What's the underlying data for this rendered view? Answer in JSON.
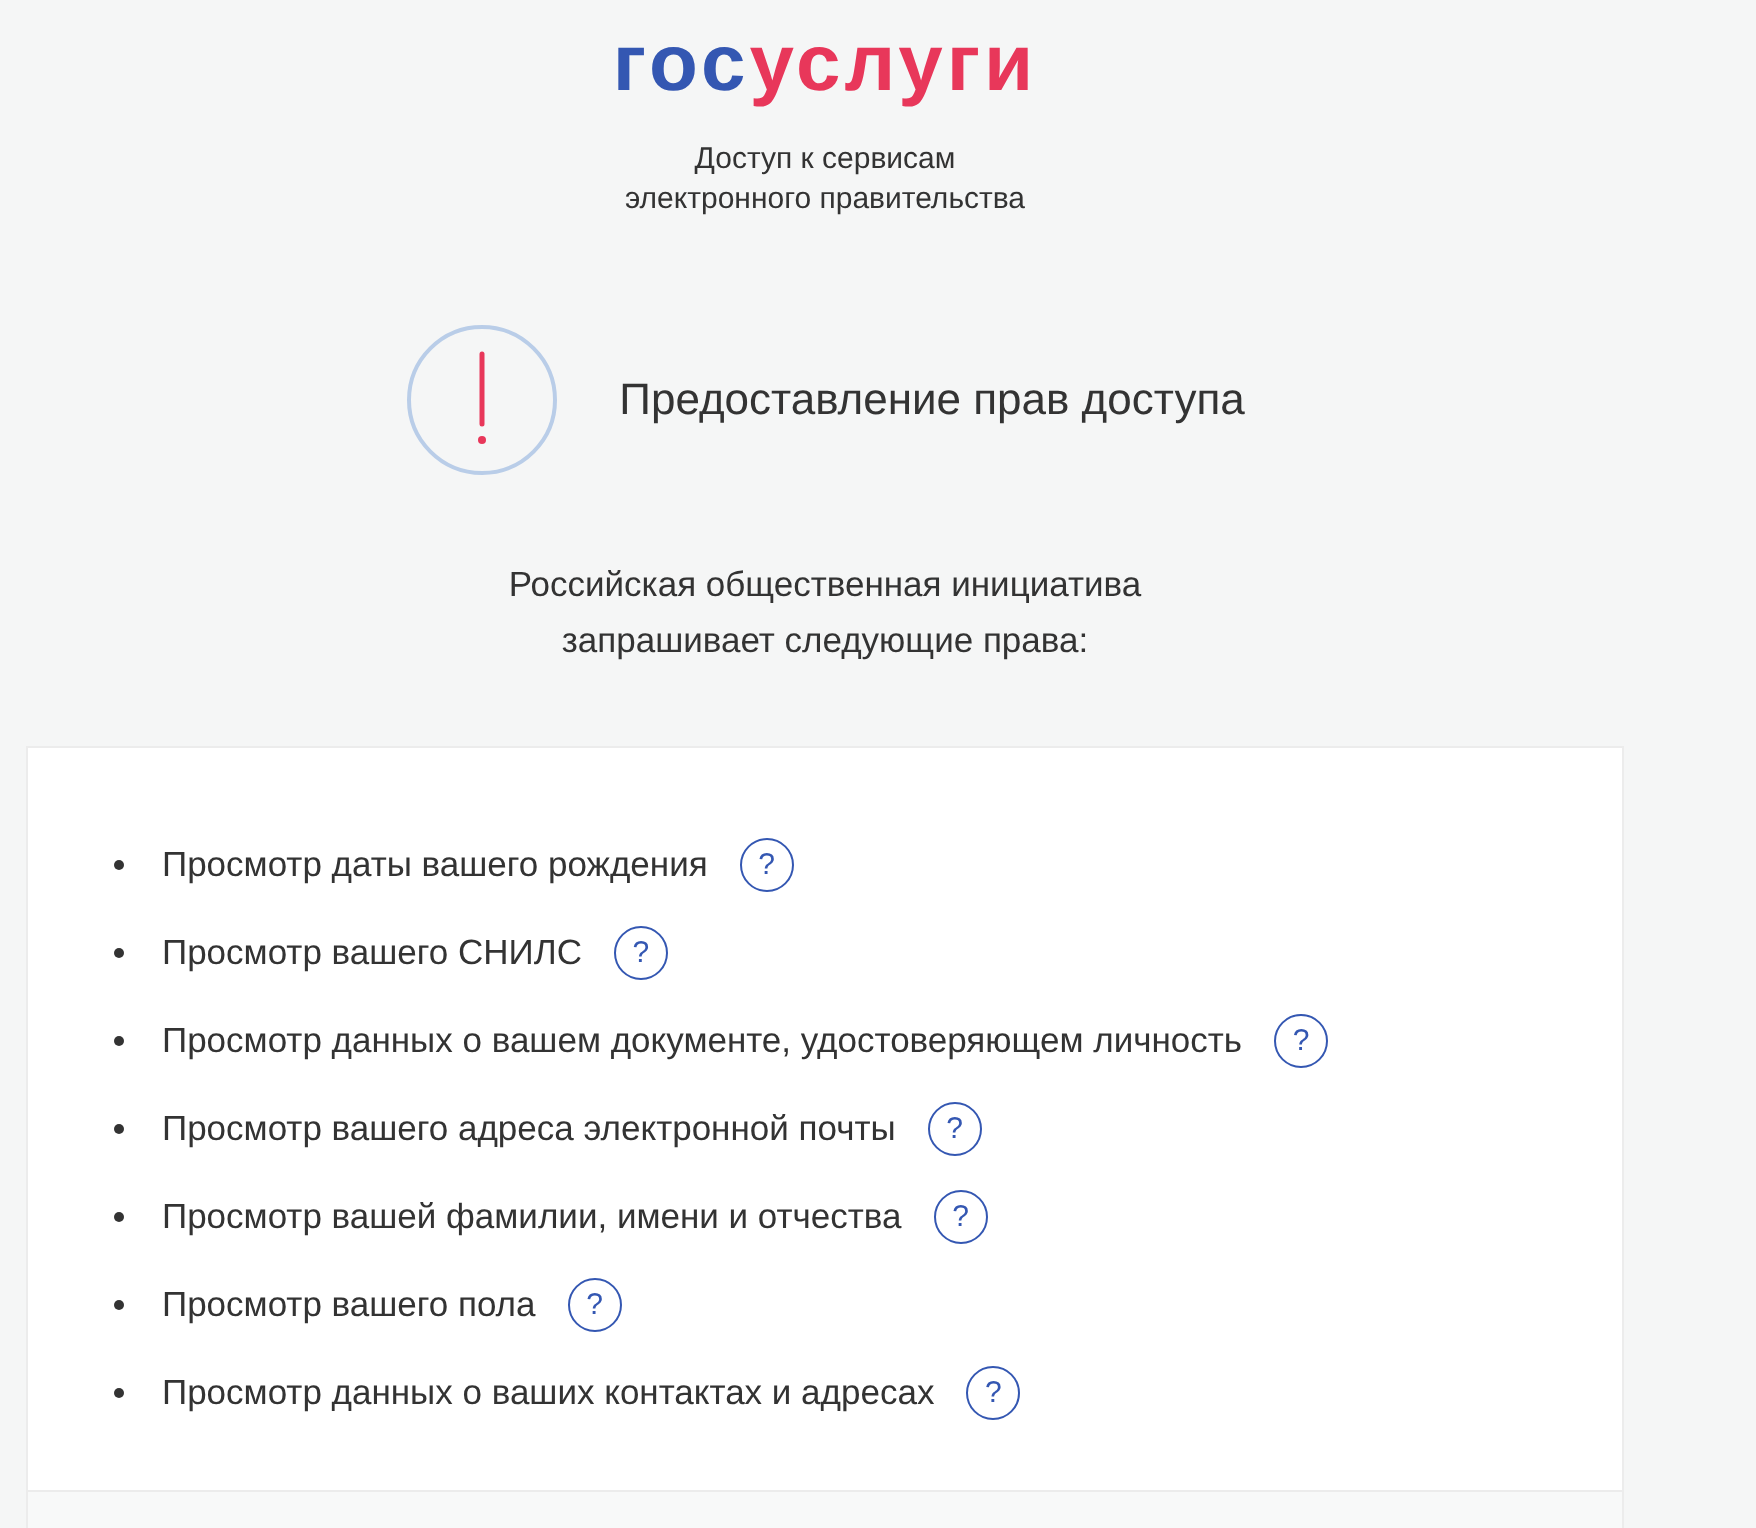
{
  "logo": {
    "parts": [
      {
        "text": "гос",
        "color": "#3457b2"
      },
      {
        "text": "услуги",
        "color": "#e8375a"
      }
    ]
  },
  "tagline": "Доступ к сервисам электронного правительства",
  "header": {
    "title": "Предоставление прав доступа"
  },
  "request_text": "Российская общественная инициатива запрашивает следующие права:",
  "permissions": [
    {
      "label": "Просмотр даты вашего рождения",
      "help": "?"
    },
    {
      "label": "Просмотр вашего СНИЛС",
      "help": "?"
    },
    {
      "label": "Просмотр данных о вашем документе, удостоверяющем личность",
      "help": "?"
    },
    {
      "label": "Просмотр вашего адреса электронной почты",
      "help": "?"
    },
    {
      "label": "Просмотр вашей фамилии, имени и отчества",
      "help": "?"
    },
    {
      "label": "Просмотр вашего пола",
      "help": "?"
    },
    {
      "label": "Просмотр данных о ваших контактах и адресах",
      "help": "?"
    }
  ]
}
